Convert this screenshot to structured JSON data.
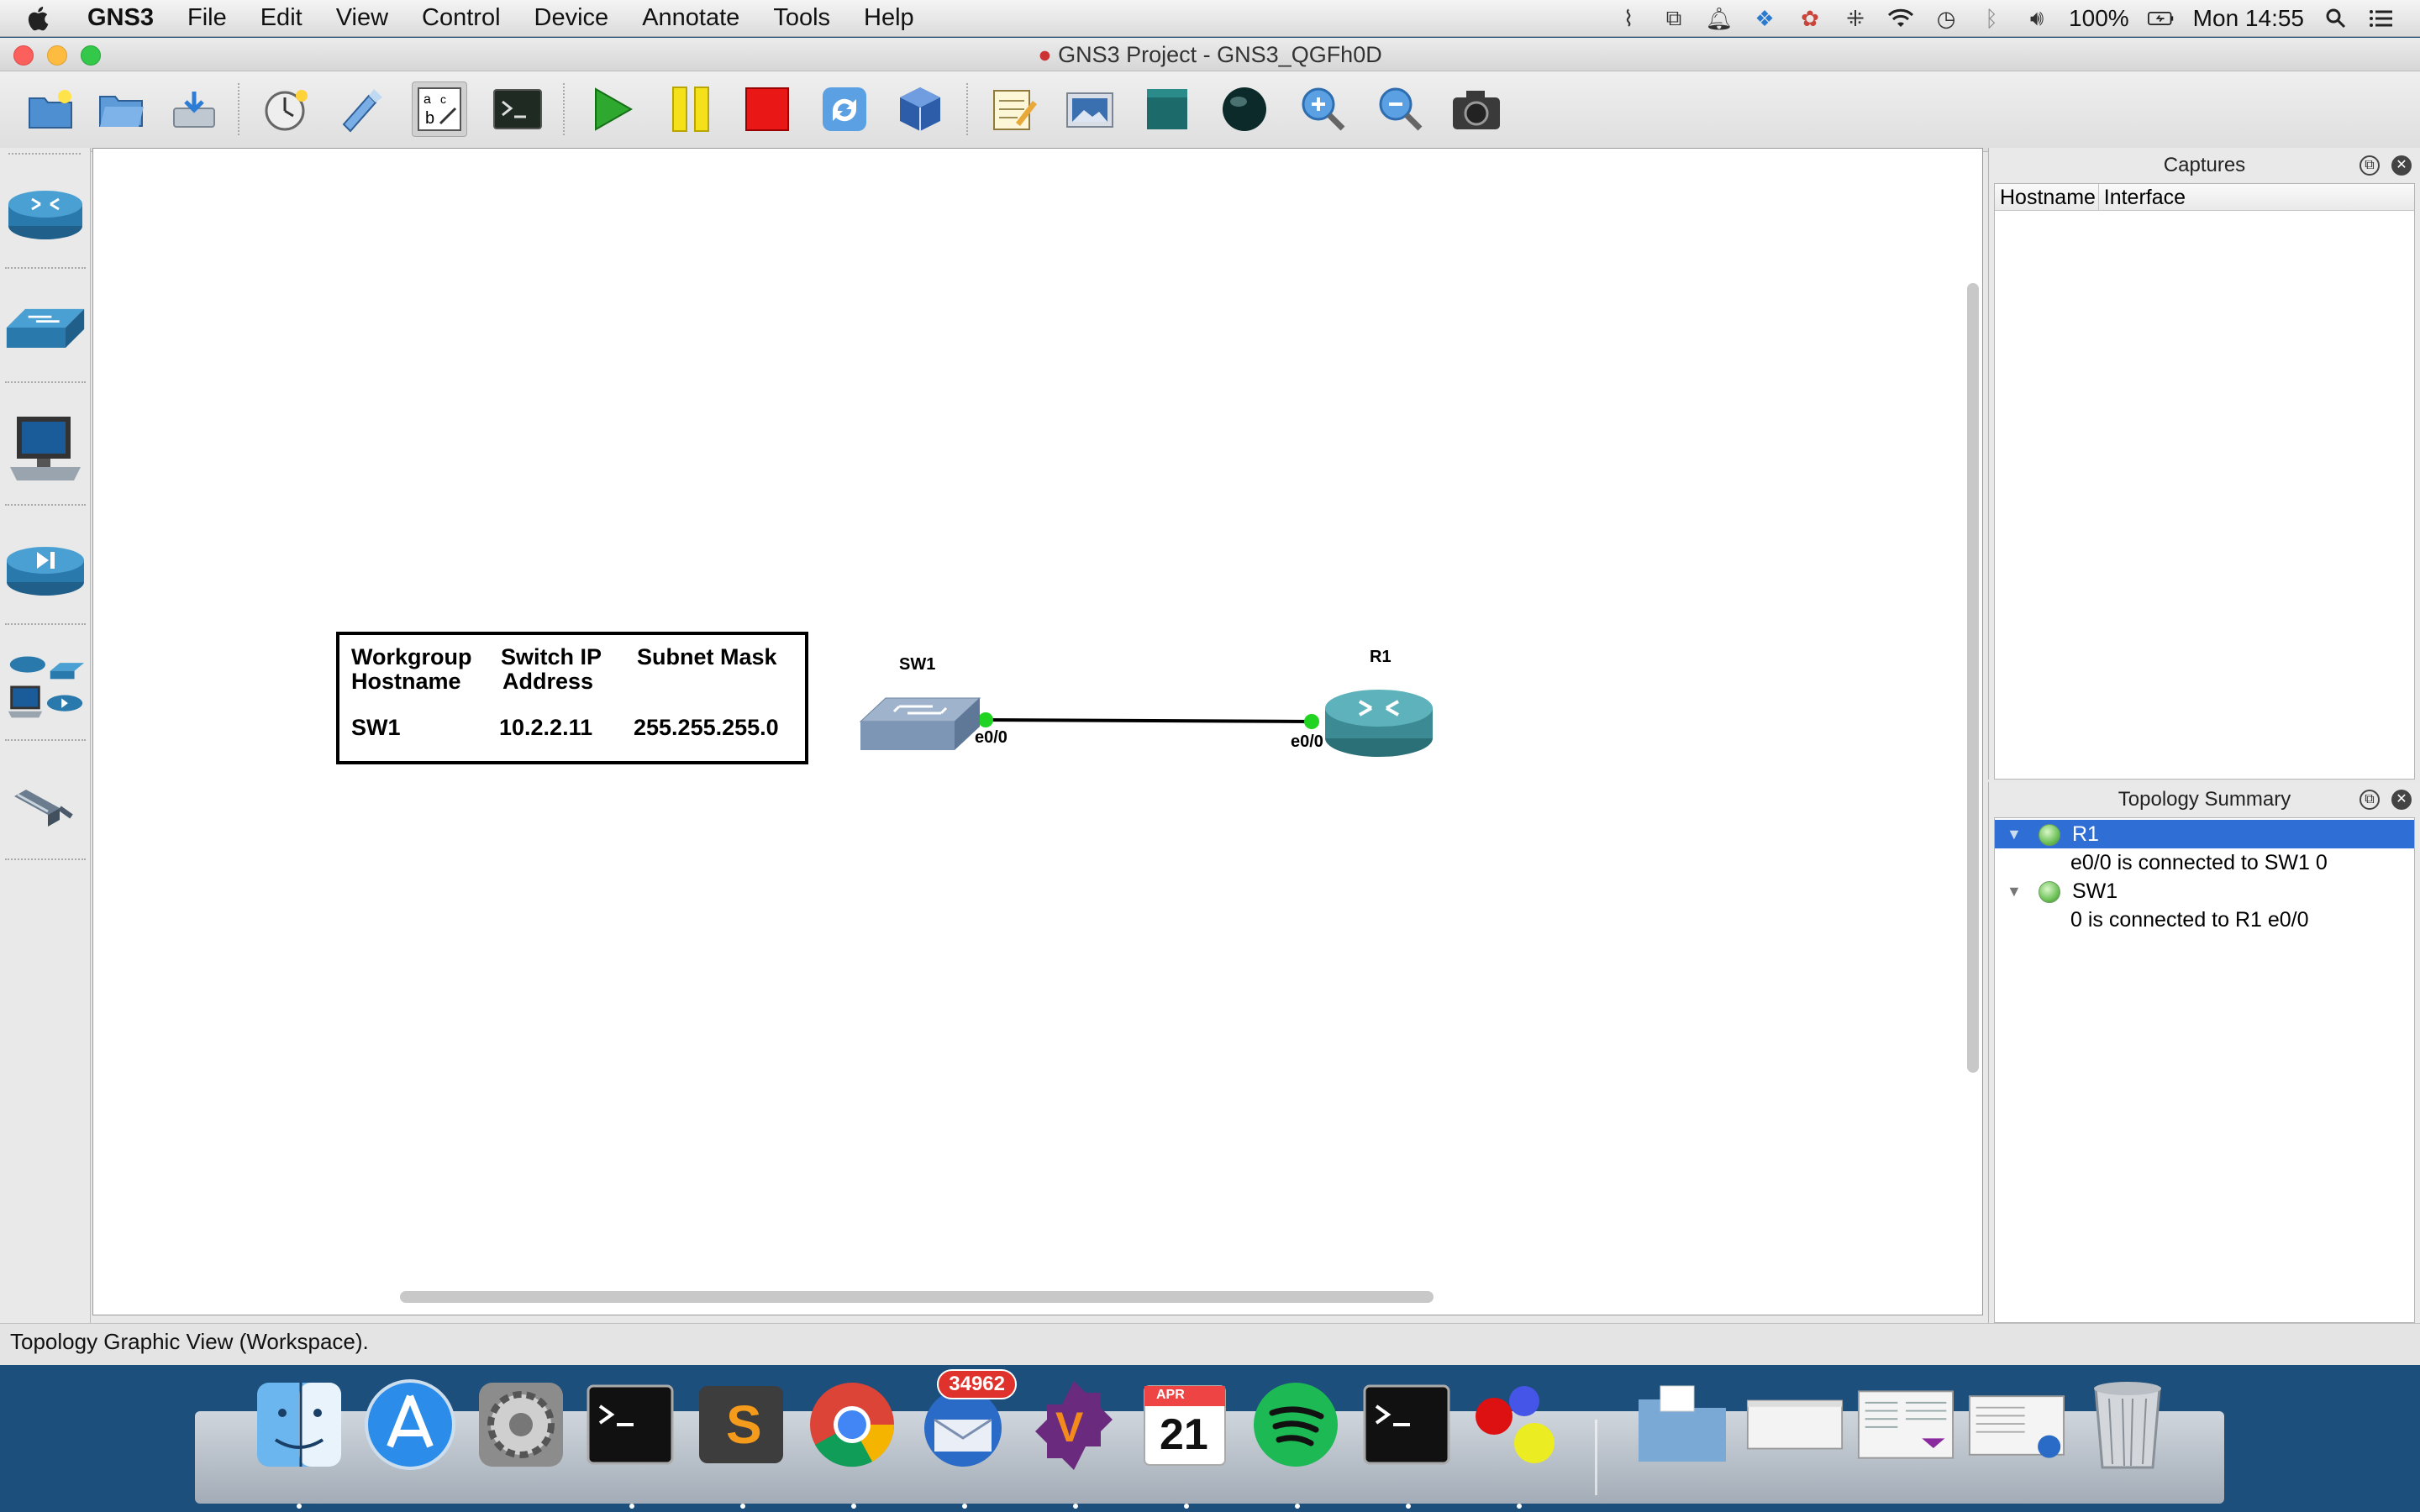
{
  "menubar": {
    "app_name": "GNS3",
    "items": [
      "File",
      "Edit",
      "View",
      "Control",
      "Device",
      "Annotate",
      "Tools",
      "Help"
    ],
    "battery": "100%",
    "clock": "Mon 14:55"
  },
  "window": {
    "title": "GNS3 Project - GNS3_QGFh0D"
  },
  "toolbar": {
    "icons": [
      "new-project",
      "open-project",
      "save-project",
      "snapshot",
      "show-interface-labels",
      "add-note",
      "console-all",
      "start-all",
      "suspend-all",
      "stop-all",
      "reload-all",
      "virtualbox",
      "add-note-edit",
      "insert-image",
      "draw-rectangle",
      "draw-ellipse",
      "zoom-in",
      "zoom-out",
      "screenshot"
    ]
  },
  "devices_dock": {
    "items": [
      "routers",
      "switches",
      "end-devices",
      "security-devices",
      "all-devices",
      "add-link"
    ]
  },
  "workspace": {
    "note": {
      "headers": [
        [
          "Workgroup",
          "Hostname"
        ],
        [
          "Switch IP",
          "Address"
        ],
        [
          "Subnet Mask",
          ""
        ]
      ],
      "row": [
        "SW1",
        "10.2.2.11",
        "255.255.255.0"
      ]
    },
    "nodes": {
      "sw1": {
        "label": "SW1",
        "port": "e0/0"
      },
      "r1": {
        "label": "R1",
        "port": "e0/0"
      }
    },
    "link_status_color": "#21d421"
  },
  "captures_panel": {
    "title": "Captures",
    "columns": [
      "Hostname",
      "Interface"
    ]
  },
  "topology_panel": {
    "title": "Topology Summary",
    "nodes": [
      {
        "name": "R1",
        "detail": "e0/0 is connected to SW1 0",
        "selected": true
      },
      {
        "name": "SW1",
        "detail": "0 is connected to R1 e0/0",
        "selected": false
      }
    ]
  },
  "statusbar": {
    "text": "Topology Graphic View (Workspace)."
  },
  "dock": {
    "apps": [
      "Finder",
      "App Store",
      "System Preferences",
      "Terminal",
      "Sublime Text",
      "Chrome",
      "Thunderbird",
      "Vivaldi",
      "Calendar",
      "Spotify",
      "Terminal",
      "Molecule app",
      "Folder",
      "Window",
      "Window",
      "Window",
      "Trash"
    ],
    "mail_badge": "34962",
    "calendar_month": "APR",
    "calendar_day": "21"
  }
}
